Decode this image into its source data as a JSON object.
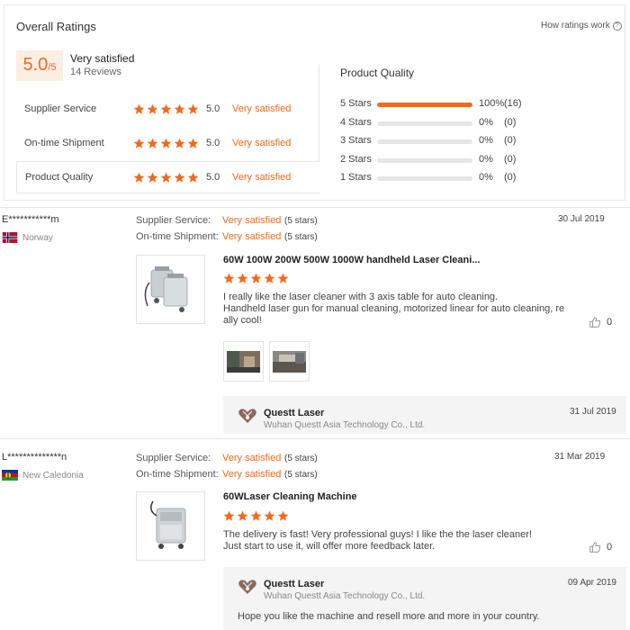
{
  "overall": {
    "title": "Overall Ratings",
    "how_link": "How ratings work",
    "score": "5.0",
    "score_of": "/5",
    "summary": "Very satisfied",
    "reviews_count": "14 Reviews",
    "categories": [
      {
        "label": "Supplier Service",
        "value": "5.0",
        "text": "Very satisfied"
      },
      {
        "label": "On-time Shipment",
        "value": "5.0",
        "text": "Very satisfied"
      },
      {
        "label": "Product Quality",
        "value": "5.0",
        "text": "Very satisfied"
      }
    ],
    "breakdown_title": "Product Quality",
    "breakdown": [
      {
        "label": "5 Stars",
        "percent": "100%",
        "count": "(16)",
        "fraction": 1.0
      },
      {
        "label": "4 Stars",
        "percent": "0%",
        "count": "(0)",
        "fraction": 0
      },
      {
        "label": "3 Stars",
        "percent": "0%",
        "count": "(0)",
        "fraction": 0
      },
      {
        "label": "2 Stars",
        "percent": "0%",
        "count": "(0)",
        "fraction": 0
      },
      {
        "label": "1 Stars",
        "percent": "0%",
        "count": "(0)",
        "fraction": 0
      }
    ]
  },
  "reviews": [
    {
      "name": "E***********m",
      "country": "Norway",
      "supplier_label": "Supplier Service:",
      "supplier_value": "Very satisfied",
      "supplier_stars": "(5 stars)",
      "shipment_label": "On-time Shipment:",
      "shipment_value": "Very satisfied",
      "shipment_stars": "(5 stars)",
      "date": "30 Jul 2019",
      "product": "60W 100W 200W 500W 1000W handheld Laser Cleani...",
      "text_line1": "I really like the laser cleaner with 3 axis table for auto cleaning.",
      "text_line2": "Handheld laser gun for manual cleaning, motorized linear for auto cleaning, re",
      "text_line3": "ally cool!",
      "likes": "0",
      "reply": {
        "company_short": "Questt Laser",
        "company_full": "Wuhan Questt Asia Technology Co., Ltd.",
        "date": "31 Jul 2019"
      }
    },
    {
      "name": "L**************n",
      "country": "New Caledonia",
      "supplier_label": "Supplier Service:",
      "supplier_value": "Very satisfied",
      "supplier_stars": "(5 stars)",
      "shipment_label": "On-time Shipment:",
      "shipment_value": "Very satisfied",
      "shipment_stars": "(5 stars)",
      "date": "31 Mar 2019",
      "product": "60WLaser Cleaning Machine",
      "text_line1": "The delivery is fast! Very professional guys! I like the the laser cleaner!",
      "text_line2": "Just start to use it, will offer more feedback later.",
      "likes": "0",
      "reply": {
        "company_short": "Questt Laser",
        "company_full": "Wuhan Questt Asia Technology Co., Ltd.",
        "date": "09 Apr 2019",
        "text": "Hope you like the machine and resell more and more in your country."
      }
    }
  ],
  "colors": {
    "accent": "#f36a1b",
    "bar_track": "#e6e6e6",
    "reply_bg": "#f4f4f4"
  }
}
